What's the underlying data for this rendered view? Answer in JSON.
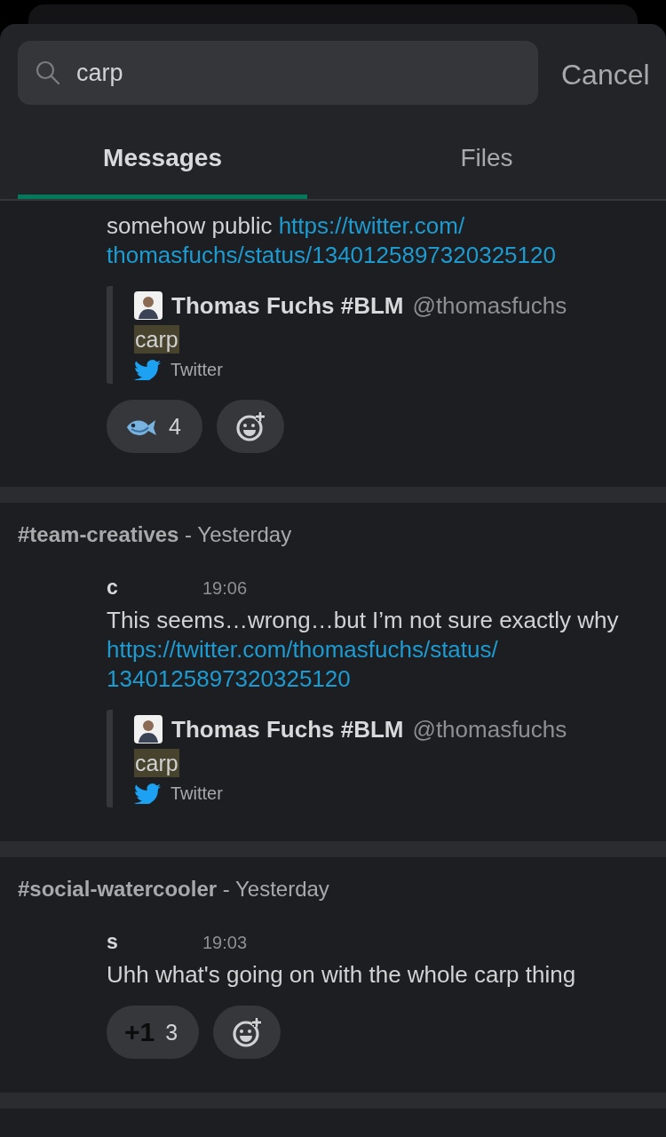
{
  "search": {
    "value": "carp",
    "cancel": "Cancel"
  },
  "tabs": [
    {
      "label": "Messages",
      "selected": true
    },
    {
      "label": "Files",
      "selected": false
    }
  ],
  "results": [
    {
      "messages": [
        {
          "text": "somehow public",
          "link": [
            "https://twitter.com/",
            "thomasfuchs/status/1340125897320325120"
          ],
          "unfurl": {
            "name": "Thomas Fuchs #BLM",
            "handle": "@thomasfuchs",
            "text": "carp",
            "highlighted": true,
            "source": "Twitter"
          },
          "reactions": [
            {
              "kind": "fish",
              "count": "4"
            }
          ],
          "add_reaction": true
        }
      ]
    },
    {
      "channel": "#team-creatives",
      "when": "- Yesterday",
      "messages": [
        {
          "author": "c",
          "time": "19:06",
          "text": "This seems…wrong…but I’m not sure exactly why",
          "link": [
            "https://twitter.com/thomasfuchs/status/",
            "1340125897320325120"
          ],
          "unfurl": {
            "name": "Thomas Fuchs #BLM",
            "handle": "@thomasfuchs",
            "text": "carp",
            "highlighted": true,
            "source": "Twitter"
          }
        }
      ]
    },
    {
      "channel": "#social-watercooler",
      "when": "- Yesterday",
      "messages": [
        {
          "author": "s",
          "time": "19:03",
          "text": "Uhh what's going on with the whole carp thing",
          "reactions": [
            {
              "kind": "text",
              "emoji": "+1",
              "count": "3"
            }
          ],
          "add_reaction": true
        }
      ]
    }
  ]
}
